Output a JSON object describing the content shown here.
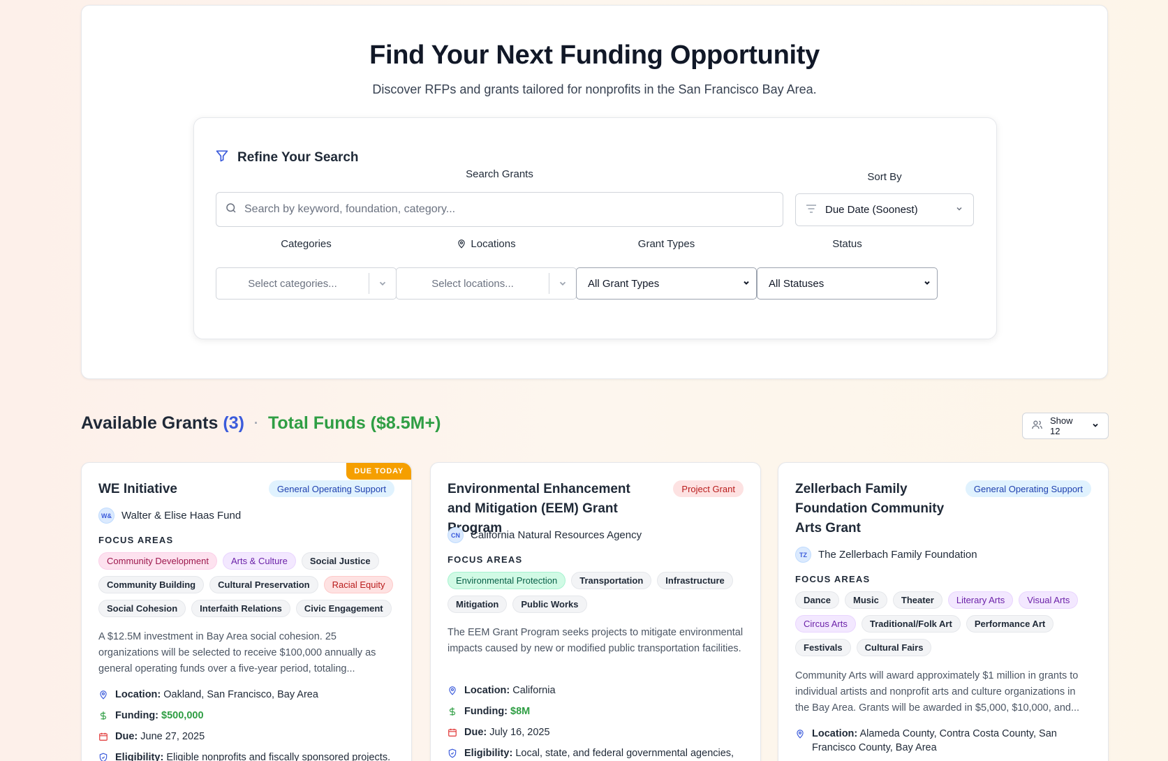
{
  "hero": {
    "title": "Find Your Next Funding Opportunity",
    "subtitle": "Discover RFPs and grants tailored for nonprofits in the San Francisco Bay Area."
  },
  "filters": {
    "title": "Refine Your Search",
    "search_label": "Search Grants",
    "search_placeholder": "Search by keyword, foundation, category...",
    "sort_label": "Sort By",
    "sort_value": "Due Date (Soonest)",
    "categories_label": "Categories",
    "categories_placeholder": "Select categories...",
    "locations_label": "Locations",
    "locations_placeholder": "Select locations...",
    "grant_types_label": "Grant Types",
    "grant_types_value": "All Grant Types",
    "status_label": "Status",
    "status_value": "All Statuses"
  },
  "results": {
    "heading": "Available Grants",
    "count": "(3)",
    "separator": "·",
    "total_funds": "Total Funds ($8.5M+)",
    "show_label": "Show 12"
  },
  "cards": [
    {
      "ribbon": "DUE TODAY",
      "title": "WE Initiative",
      "type": "General Operating Support",
      "org_initials": "W&",
      "org": "Walter & Elise Haas Fund",
      "focus_label": "FOCUS AREAS",
      "tags": [
        {
          "label": "Community Development",
          "color": "pink"
        },
        {
          "label": "Arts & Culture",
          "color": "purple"
        },
        {
          "label": "Social Justice",
          "color": "gray"
        },
        {
          "label": "Community Building",
          "color": "gray"
        },
        {
          "label": "Cultural Preservation",
          "color": "gray"
        },
        {
          "label": "Racial Equity",
          "color": "red"
        },
        {
          "label": "Social Cohesion",
          "color": "gray"
        },
        {
          "label": "Interfaith Relations",
          "color": "gray"
        },
        {
          "label": "Civic Engagement",
          "color": "gray"
        }
      ],
      "description": "A $12.5M investment in Bay Area social cohesion. 25 organizations will be selected to receive $100,000 annually as general operating funds over a five-year period, totaling...",
      "location_label": "Location:",
      "location": "Oakland, San Francisco, Bay Area",
      "funding_label": "Funding:",
      "funding": "$500,000",
      "due_label": "Due:",
      "due": "June 27, 2025",
      "eligibility_label": "Eligibility:",
      "eligibility": "Eligible nonprofits and fiscally sponsored projects."
    },
    {
      "title": "Environmental Enhancement and Mitigation (EEM) Grant Program",
      "type": "Project Grant",
      "org_initials": "CN",
      "org": "California Natural Resources Agency",
      "focus_label": "FOCUS AREAS",
      "tags": [
        {
          "label": "Environmental Protection",
          "color": "green"
        },
        {
          "label": "Transportation",
          "color": "gray"
        },
        {
          "label": "Infrastructure",
          "color": "gray"
        },
        {
          "label": "Mitigation",
          "color": "gray"
        },
        {
          "label": "Public Works",
          "color": "gray"
        }
      ],
      "description": "The EEM Grant Program seeks projects to mitigate environmental impacts caused by new or modified public transportation facilities.",
      "location_label": "Location:",
      "location": "California",
      "funding_label": "Funding:",
      "funding": "$8M",
      "due_label": "Due:",
      "due": "July 16, 2025",
      "eligibility_label": "Eligibility:",
      "eligibility": "Local, state, and federal governmental agencies,"
    },
    {
      "title": "Zellerbach Family Foundation Community Arts Grant",
      "type": "General Operating Support",
      "org_initials": "TZ",
      "org": "The Zellerbach Family Foundation",
      "focus_label": "FOCUS AREAS",
      "tags": [
        {
          "label": "Dance",
          "color": "gray"
        },
        {
          "label": "Music",
          "color": "gray"
        },
        {
          "label": "Theater",
          "color": "gray"
        },
        {
          "label": "Literary Arts",
          "color": "purple"
        },
        {
          "label": "Visual Arts",
          "color": "purple"
        },
        {
          "label": "Circus Arts",
          "color": "purple"
        },
        {
          "label": "Traditional/Folk Art",
          "color": "gray"
        },
        {
          "label": "Performance Art",
          "color": "gray"
        },
        {
          "label": "Festivals",
          "color": "gray"
        },
        {
          "label": "Cultural Fairs",
          "color": "gray"
        }
      ],
      "description": "Community Arts will award approximately $1 million in grants to individual artists and nonprofit arts and culture organizations in the Bay Area. Grants will be awarded in $5,000, $10,000, and...",
      "location_label": "Location:",
      "location": "Alameda County, Contra Costa County, San Francisco County, Bay Area"
    }
  ]
}
